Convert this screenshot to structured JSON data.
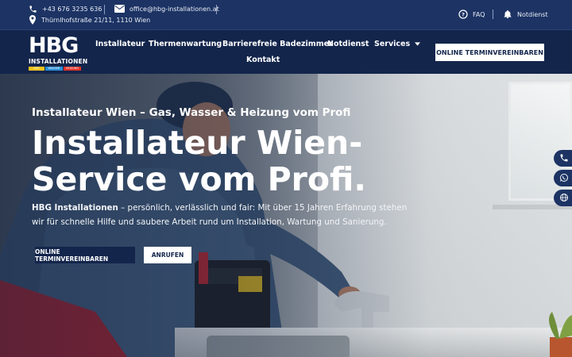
{
  "topbar": {
    "phone": "+43 676 3235 636",
    "email": "office@hbg-installationen.at",
    "address": "Thürnlhofstraße 21/11, 1110 Wien",
    "faq": "FAQ",
    "notdienst": "Notdienst",
    "icons": [
      "phone-icon",
      "mail-icon",
      "location-pin-icon",
      "question-circle-icon",
      "bell-icon"
    ]
  },
  "logo": {
    "main": "HBG",
    "sub": "INSTALLATIONEN",
    "tags": [
      "GAS",
      "WASSER",
      "HEIZUNG"
    ],
    "tag_colors": [
      "#f2c21b",
      "#2b8fd6",
      "#e2332a"
    ]
  },
  "nav": {
    "items": [
      "Installateur",
      "Thermenwartung",
      "Barrierefreie Badezimmer",
      "Notdienst",
      "Services",
      "Kontakt"
    ],
    "cta": "ONLINE TERMINVEREINBAREN"
  },
  "hero": {
    "subtitle": "Installateur Wien – Gas, Wasser & Heizung vom Profi",
    "title_line1": "Installateur Wien-",
    "title_line2": "Service vom Profi.",
    "text_strong": "HBG Installationen",
    "text_rest": " – persönlich, verlässlich und fair: Mit über 15 Jahren Erfahrung stehen wir für schnelle Hilfe und saubere Arbeit rund um Installation, Wartung und Sanierung.",
    "btn_primary": "ONLINE TERMINVEREINBAREN",
    "btn_secondary": "ANRUFEN"
  },
  "floating": [
    "phone-icon",
    "whatsapp-icon",
    "globe-icon"
  ],
  "colors": {
    "navy": "#13254b",
    "topbar": "#1c3364",
    "white": "#ffffff"
  }
}
